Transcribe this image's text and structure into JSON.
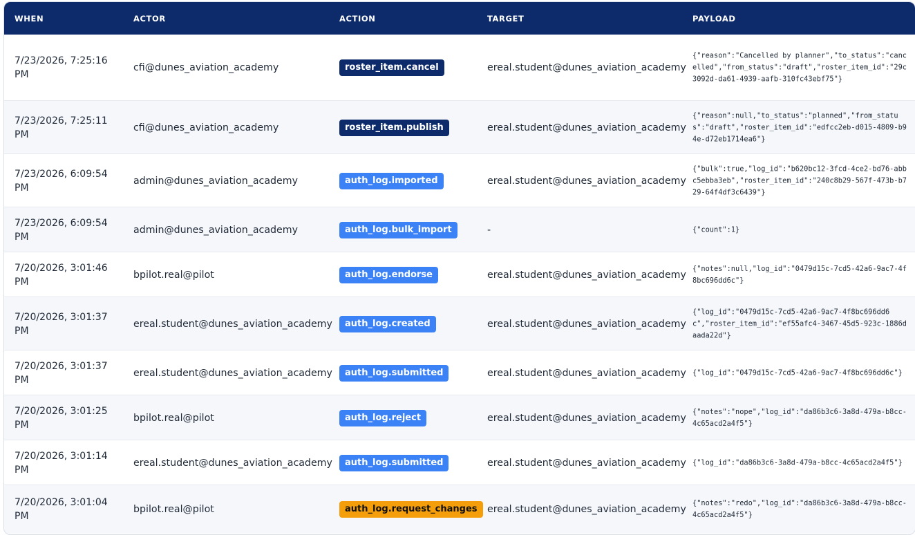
{
  "colors": {
    "header_bg": "#0d2b6b",
    "badge_navy": "#0d2b6b",
    "badge_blue": "#3b82f6",
    "badge_amber": "#f59e0b"
  },
  "columns": {
    "when": "WHEN",
    "actor": "ACTOR",
    "action": "ACTION",
    "target": "TARGET",
    "payload": "PAYLOAD"
  },
  "rows": [
    {
      "when": "7/23/2026, 7:25:16 PM",
      "actor": "cfi@dunes_aviation_academy",
      "action": "roster_item.cancel",
      "action_style": "navy",
      "target": "ereal.student@dunes_aviation_academy",
      "payload": "{\"reason\":\"Cancelled by planner\",\"to_status\":\"cancelled\",\"from_status\":\"draft\",\"roster_item_id\":\"29c3092d-da61-4939-aafb-310fc43ebf75\"}"
    },
    {
      "when": "7/23/2026, 7:25:11 PM",
      "actor": "cfi@dunes_aviation_academy",
      "action": "roster_item.publish",
      "action_style": "navy",
      "target": "ereal.student@dunes_aviation_academy",
      "payload": "{\"reason\":null,\"to_status\":\"planned\",\"from_status\":\"draft\",\"roster_item_id\":\"edfcc2eb-d015-4809-b94e-d72eb1714ea6\"}"
    },
    {
      "when": "7/23/2026, 6:09:54 PM",
      "actor": "admin@dunes_aviation_academy",
      "action": "auth_log.imported",
      "action_style": "blue",
      "target": "ereal.student@dunes_aviation_academy",
      "payload": "{\"bulk\":true,\"log_id\":\"b620bc12-3fcd-4ce2-bd76-abbc5ebba3eb\",\"roster_item_id\":\"240c8b29-567f-473b-b729-64f4df3c6439\"}"
    },
    {
      "when": "7/23/2026, 6:09:54 PM",
      "actor": "admin@dunes_aviation_academy",
      "action": "auth_log.bulk_import",
      "action_style": "blue",
      "target": "-",
      "payload": "{\"count\":1}"
    },
    {
      "when": "7/20/2026, 3:01:46 PM",
      "actor": "bpilot.real@pilot",
      "action": "auth_log.endorse",
      "action_style": "blue",
      "target": "ereal.student@dunes_aviation_academy",
      "payload": "{\"notes\":null,\"log_id\":\"0479d15c-7cd5-42a6-9ac7-4f8bc696dd6c\"}"
    },
    {
      "when": "7/20/2026, 3:01:37 PM",
      "actor": "ereal.student@dunes_aviation_academy",
      "action": "auth_log.created",
      "action_style": "blue",
      "target": "ereal.student@dunes_aviation_academy",
      "payload": "{\"log_id\":\"0479d15c-7cd5-42a6-9ac7-4f8bc696dd6c\",\"roster_item_id\":\"ef55afc4-3467-45d5-923c-1886daada22d\"}"
    },
    {
      "when": "7/20/2026, 3:01:37 PM",
      "actor": "ereal.student@dunes_aviation_academy",
      "action": "auth_log.submitted",
      "action_style": "blue",
      "target": "ereal.student@dunes_aviation_academy",
      "payload": "{\"log_id\":\"0479d15c-7cd5-42a6-9ac7-4f8bc696dd6c\"}"
    },
    {
      "when": "7/20/2026, 3:01:25 PM",
      "actor": "bpilot.real@pilot",
      "action": "auth_log.reject",
      "action_style": "blue",
      "target": "ereal.student@dunes_aviation_academy",
      "payload": "{\"notes\":\"nope\",\"log_id\":\"da86b3c6-3a8d-479a-b8cc-4c65acd2a4f5\"}"
    },
    {
      "when": "7/20/2026, 3:01:14 PM",
      "actor": "ereal.student@dunes_aviation_academy",
      "action": "auth_log.submitted",
      "action_style": "blue",
      "target": "ereal.student@dunes_aviation_academy",
      "payload": "{\"log_id\":\"da86b3c6-3a8d-479a-b8cc-4c65acd2a4f5\"}"
    },
    {
      "when": "7/20/2026, 3:01:04 PM",
      "actor": "bpilot.real@pilot",
      "action": "auth_log.request_changes",
      "action_style": "amber",
      "target": "ereal.student@dunes_aviation_academy",
      "payload": "{\"notes\":\"redo\",\"log_id\":\"da86b3c6-3a8d-479a-b8cc-4c65acd2a4f5\"}"
    }
  ]
}
